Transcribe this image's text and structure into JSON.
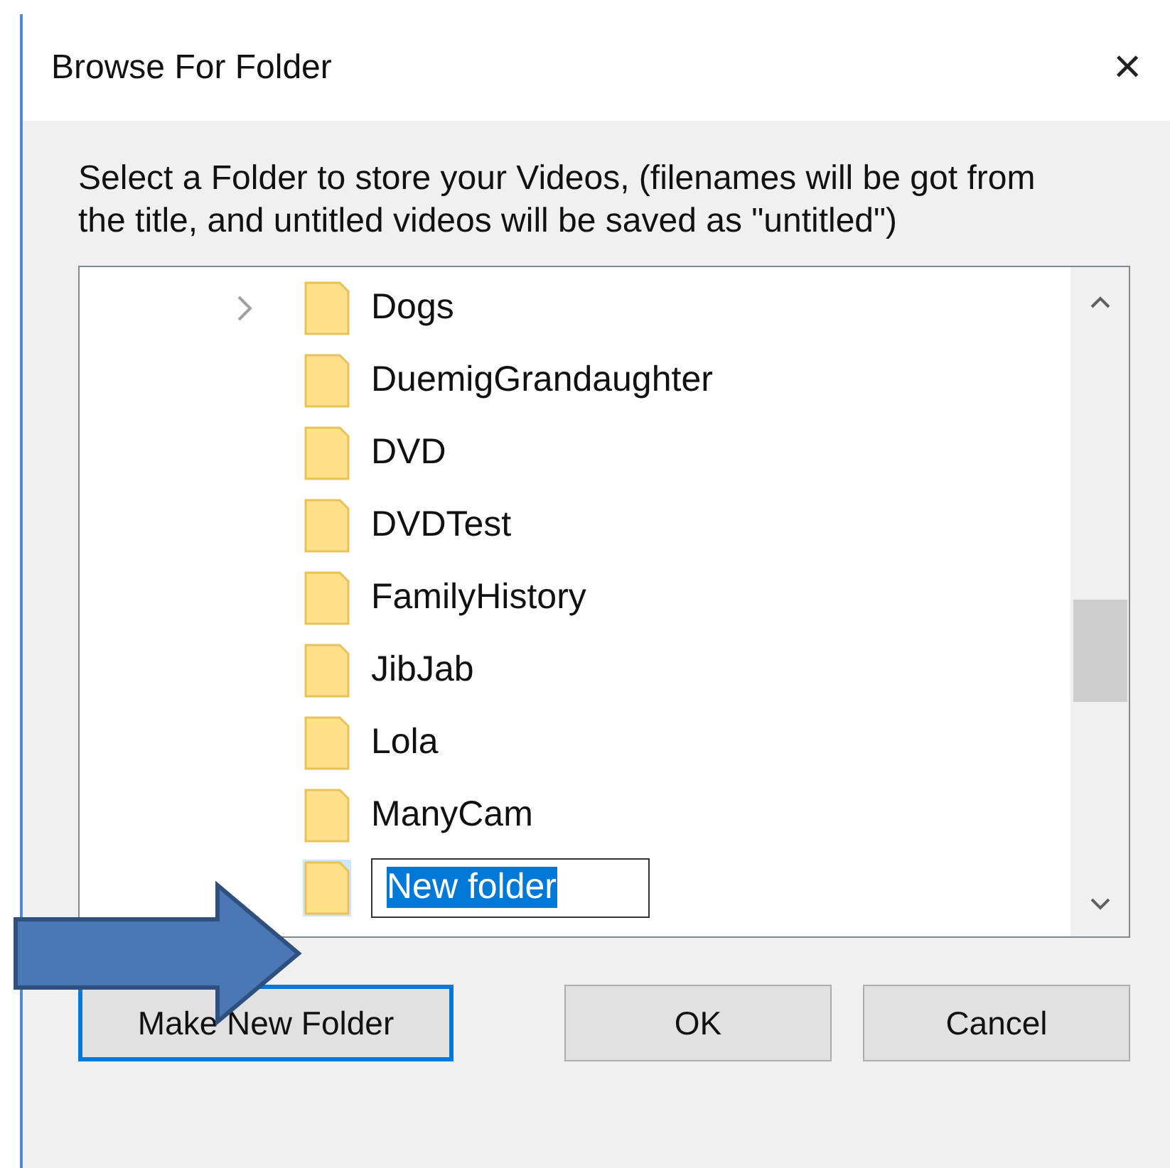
{
  "window": {
    "title": "Browse For Folder",
    "close": "×"
  },
  "instruction": "Select a Folder to store your Videos, (filenames will be got from the title, and untitled videos will be saved as \"untitled\")",
  "tree": {
    "items": [
      {
        "name": "Dogs",
        "expandable": true,
        "selected": false,
        "editing": false
      },
      {
        "name": "DuemigGrandaughter",
        "expandable": false,
        "selected": false,
        "editing": false
      },
      {
        "name": "DVD",
        "expandable": false,
        "selected": false,
        "editing": false
      },
      {
        "name": "DVDTest",
        "expandable": false,
        "selected": false,
        "editing": false
      },
      {
        "name": "FamilyHistory",
        "expandable": false,
        "selected": false,
        "editing": false
      },
      {
        "name": "JibJab",
        "expandable": false,
        "selected": false,
        "editing": false
      },
      {
        "name": "Lola",
        "expandable": false,
        "selected": false,
        "editing": false
      },
      {
        "name": "ManyCam",
        "expandable": false,
        "selected": false,
        "editing": false
      },
      {
        "name": "New folder",
        "expandable": false,
        "selected": true,
        "editing": true
      }
    ]
  },
  "buttons": [
    {
      "label": "Make New Folder",
      "focused": true
    },
    {
      "label": "OK",
      "focused": false
    },
    {
      "label": "Cancel",
      "focused": false
    }
  ],
  "annotation": {
    "kind": "arrow"
  }
}
